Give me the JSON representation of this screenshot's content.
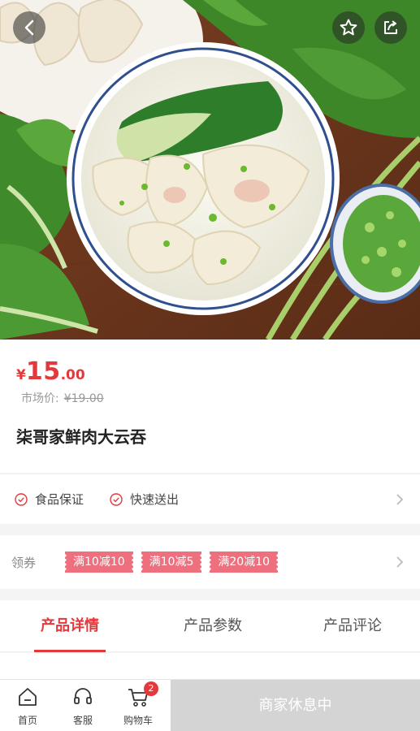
{
  "hero": {
    "back_icon": "chevron-left-icon",
    "favorite_icon": "star-icon",
    "share_icon": "share-icon"
  },
  "product": {
    "currency_symbol": "¥",
    "price_integer": "15",
    "price_decimal": ".00",
    "market_label": "市场价:",
    "market_price": "¥19.00",
    "title": "柒哥家鲜肉大云吞",
    "accent_color": "#e4393c"
  },
  "guarantees": [
    {
      "label": "食品保证",
      "icon": "check-circle-icon"
    },
    {
      "label": "快速送出",
      "icon": "check-circle-icon"
    }
  ],
  "coupons": {
    "label": "领券",
    "items": [
      "满10减10",
      "满10减5",
      "满20减10"
    ],
    "color": "#ee6f7d"
  },
  "tabs": [
    {
      "label": "产品详情",
      "active": true
    },
    {
      "label": "产品参数",
      "active": false
    },
    {
      "label": "产品评论",
      "active": false
    }
  ],
  "bottom_nav": {
    "home_label": "首页",
    "service_label": "客服",
    "cart_label": "购物车",
    "cart_count": "2",
    "status_button": "商家休息中"
  }
}
